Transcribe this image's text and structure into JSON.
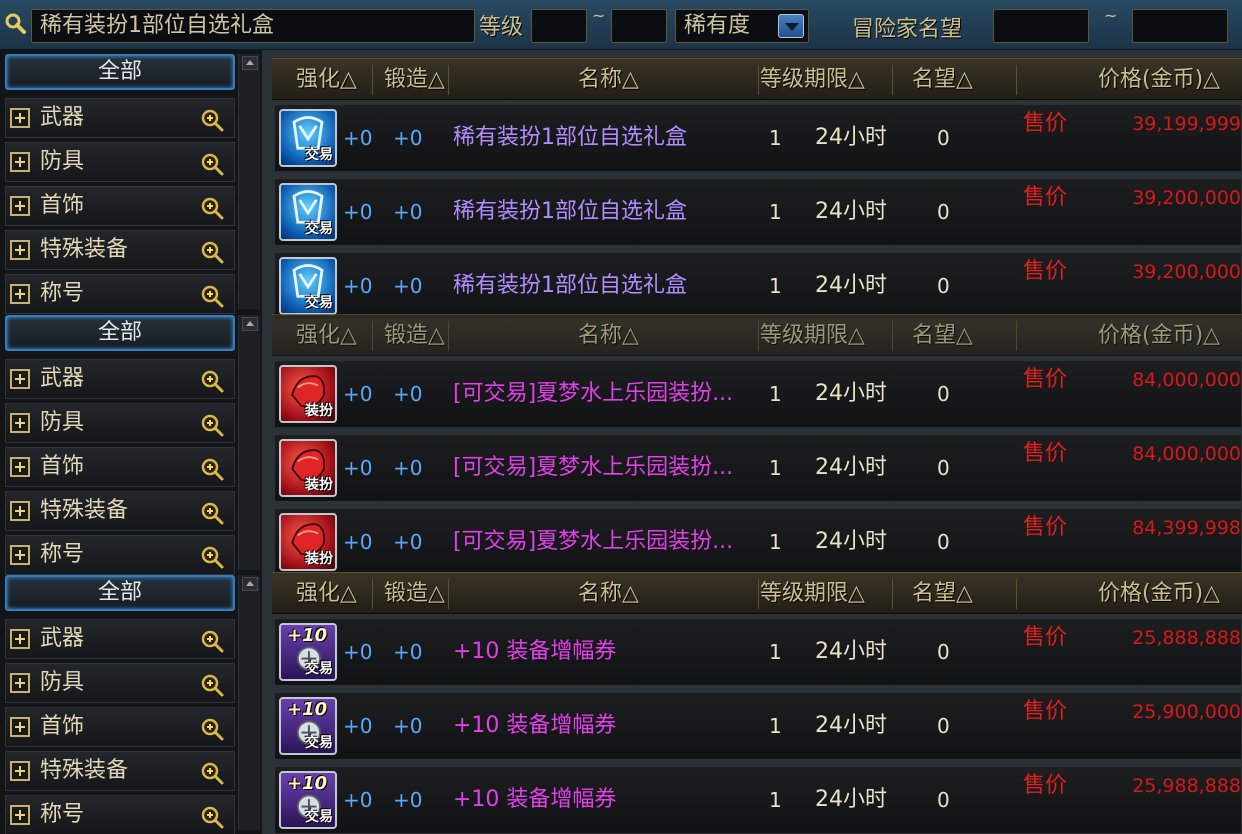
{
  "search": {
    "query": "稀有装扮1部位自选礼盒",
    "level_label": "等级",
    "tilde": "~",
    "rarity_label": "稀有度",
    "fame_label": "冒险家名望"
  },
  "sidebar": {
    "groups": [
      {
        "all_label": "全部",
        "items": [
          "武器",
          "防具",
          "首饰",
          "特殊装备",
          "称号"
        ]
      },
      {
        "all_label": "全部",
        "items": [
          "武器",
          "防具",
          "首饰",
          "特殊装备",
          "称号"
        ]
      },
      {
        "all_label": "全部",
        "items": [
          "武器",
          "防具",
          "首饰",
          "特殊装备",
          "称号"
        ]
      }
    ]
  },
  "columns": {
    "strengthen": "强化△",
    "forge": "锻造△",
    "name": "名称△",
    "level_expire": "等级期限△",
    "fame": "名望△",
    "price": "价格(金币)△"
  },
  "listings": [
    {
      "rows": [
        {
          "icon": "trade-box-icon",
          "icon_tag": "交易",
          "strengthen": "+0",
          "forge": "+0",
          "name": "稀有装扮1部位自选礼盒",
          "level": "1",
          "expire": "24小时",
          "fame": "0",
          "sell_label": "售价",
          "price": "39,199,999"
        },
        {
          "icon": "trade-box-icon",
          "icon_tag": "交易",
          "strengthen": "+0",
          "forge": "+0",
          "name": "稀有装扮1部位自选礼盒",
          "level": "1",
          "expire": "24小时",
          "fame": "0",
          "sell_label": "售价",
          "price": "39,200,000"
        },
        {
          "icon": "trade-box-icon",
          "icon_tag": "交易",
          "strengthen": "+0",
          "forge": "+0",
          "name": "稀有装扮1部位自选礼盒",
          "level": "1",
          "expire": "24小时",
          "fame": "0",
          "sell_label": "售价",
          "price": "39,200,000"
        }
      ]
    },
    {
      "rows": [
        {
          "icon": "costume-box-icon",
          "icon_tag": "装扮",
          "strengthen": "+0",
          "forge": "+0",
          "name": "[可交易]夏梦水上乐园装扮...",
          "level": "1",
          "expire": "24小时",
          "fame": "0",
          "sell_label": "售价",
          "price": "84,000,000"
        },
        {
          "icon": "costume-box-icon",
          "icon_tag": "装扮",
          "strengthen": "+0",
          "forge": "+0",
          "name": "[可交易]夏梦水上乐园装扮...",
          "level": "1",
          "expire": "24小时",
          "fame": "0",
          "sell_label": "售价",
          "price": "84,000,000"
        },
        {
          "icon": "costume-box-icon",
          "icon_tag": "装扮",
          "strengthen": "+0",
          "forge": "+0",
          "name": "[可交易]夏梦水上乐园装扮...",
          "level": "1",
          "expire": "24小时",
          "fame": "0",
          "sell_label": "售价",
          "price": "84,399,998"
        }
      ]
    },
    {
      "rows": [
        {
          "icon": "amplify-ticket-icon",
          "icon_tag": "交易",
          "icon_badge": "+10",
          "strengthen": "+0",
          "forge": "+0",
          "name": "+10 装备增幅券",
          "level": "1",
          "expire": "24小时",
          "fame": "0",
          "sell_label": "售价",
          "price": "25,888,888"
        },
        {
          "icon": "amplify-ticket-icon",
          "icon_tag": "交易",
          "icon_badge": "+10",
          "strengthen": "+0",
          "forge": "+0",
          "name": "+10 装备增幅券",
          "level": "1",
          "expire": "24小时",
          "fame": "0",
          "sell_label": "售价",
          "price": "25,900,000"
        },
        {
          "icon": "amplify-ticket-icon",
          "icon_tag": "交易",
          "icon_badge": "+10",
          "strengthen": "+0",
          "forge": "+0",
          "name": "+10 装备增幅券",
          "level": "1",
          "expire": "24小时",
          "fame": "0",
          "sell_label": "售价",
          "price": "25,988,888"
        }
      ]
    }
  ],
  "colors": {
    "name_purple": "#b28cff",
    "name_magenta": "#e040e8",
    "price_red": "#d81818",
    "accent_blue": "#2f7fc0"
  }
}
